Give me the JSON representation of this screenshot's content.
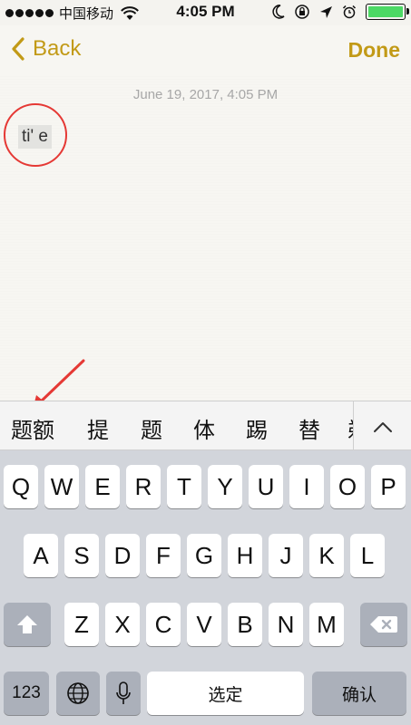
{
  "status_bar": {
    "carrier": "中国移动",
    "time": "4:05 PM"
  },
  "nav": {
    "back_label": "Back",
    "done_label": "Done"
  },
  "note": {
    "date": "June 19, 2017, 4:05 PM",
    "text": "ti' e"
  },
  "candidates": [
    "题额",
    "提",
    "题",
    "体",
    "踢",
    "替",
    "剃"
  ],
  "keyboard": {
    "row1": [
      "Q",
      "W",
      "E",
      "R",
      "T",
      "Y",
      "U",
      "I",
      "O",
      "P"
    ],
    "row2": [
      "A",
      "S",
      "D",
      "F",
      "G",
      "H",
      "J",
      "K",
      "L"
    ],
    "row3": [
      "Z",
      "X",
      "C",
      "V",
      "B",
      "N",
      "M"
    ],
    "numbers_label": "123",
    "space_label": "选定",
    "return_label": "确认"
  },
  "icons": {
    "back": "chevron-left-icon",
    "expand": "chevron-up-icon",
    "shift": "shift-icon",
    "delete": "delete-icon",
    "globe": "globe-icon",
    "mic": "microphone-icon"
  },
  "colors": {
    "accent": "#c29a17",
    "annotation": "#e53935",
    "battery": "#4cd964"
  }
}
